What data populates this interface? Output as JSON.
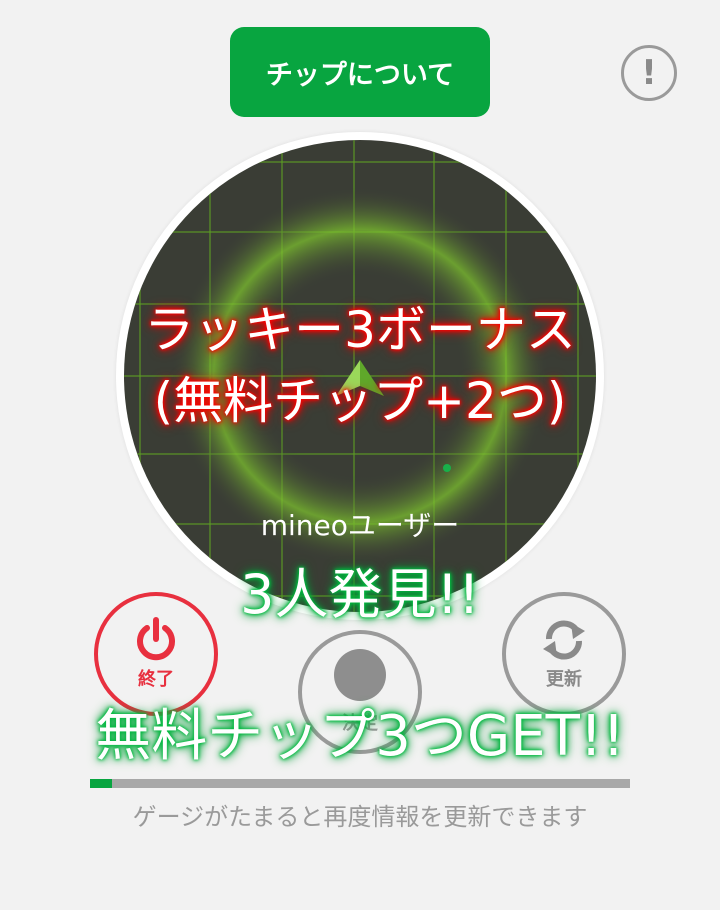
{
  "header": {
    "about_label": "チップについて",
    "info_glyph": "!"
  },
  "radar": {
    "users_label": "mineoユーザー"
  },
  "overlay": {
    "bonus_title": "ラッキー3ボーナス",
    "bonus_subtitle": "(無料チップ+2つ)",
    "found_text": "3人発見!!",
    "get_text": "無料チップ3つGET!!"
  },
  "controls": {
    "end_label": "終了",
    "decide_label": "決定",
    "refresh_label": "更新"
  },
  "gauge": {
    "fill_fraction": 0.04,
    "hint": "ゲージがたまると再度情報を更新できます"
  },
  "colors": {
    "brand_green": "#08a540",
    "end_red": "#e8303f",
    "radar_dark": "#3a3d35",
    "radar_glow": "#74b82a"
  },
  "icons": {
    "info": "exclamation-icon",
    "end": "power-icon",
    "refresh": "refresh-icon",
    "user_marker": "arrow-marker-icon"
  }
}
